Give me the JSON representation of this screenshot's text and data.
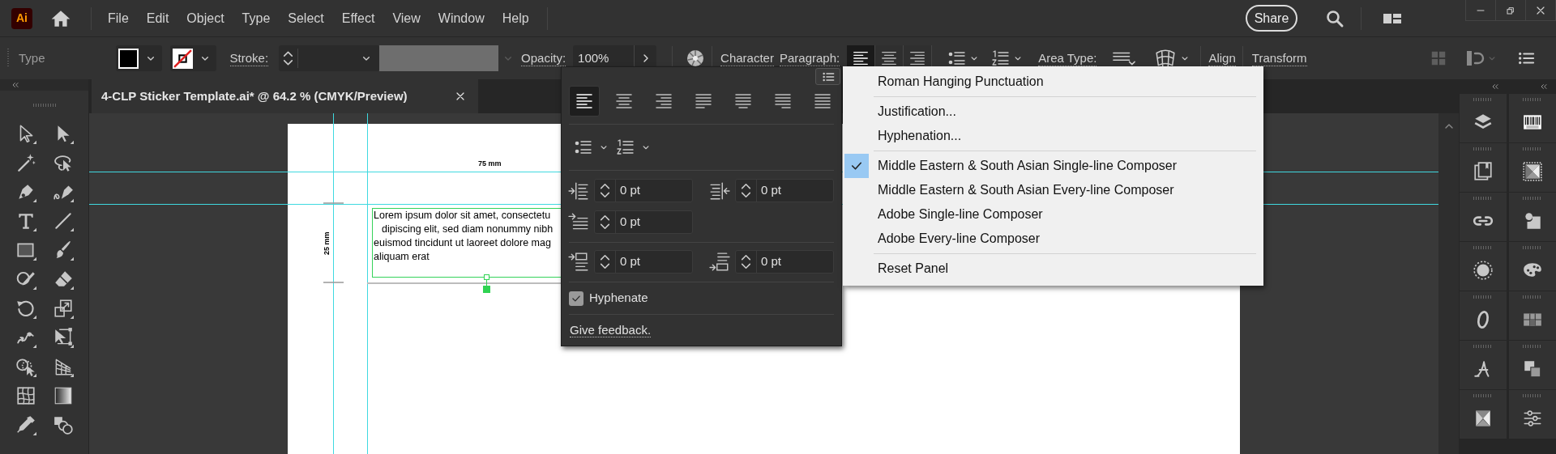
{
  "app_bar": {
    "logo": "Ai",
    "menu": [
      "File",
      "Edit",
      "Object",
      "Type",
      "Select",
      "Effect",
      "View",
      "Window",
      "Help"
    ],
    "share_button": "Share"
  },
  "control_bar": {
    "tool_name": "Type",
    "stroke_label": "Stroke:",
    "opacity_label": "Opacity:",
    "opacity_value": "100%",
    "character_link": "Character",
    "paragraph_link": "Paragraph:",
    "align_buttons": [
      {
        "kind": "left",
        "selected": true
      },
      {
        "kind": "center",
        "selected": false
      },
      {
        "kind": "right",
        "selected": false
      }
    ],
    "area_type_label": "Area Type:",
    "align_link": "Align",
    "transform_link": "Transform"
  },
  "document_tab": {
    "title": "4-CLP Sticker Template.ai* @ 64.2 % (CMYK/Preview)"
  },
  "artboard": {
    "width_label": "75 mm",
    "height_label": "25 mm",
    "text_lines": [
      "Lorem ipsum dolor sit amet, consectetu",
      "dipiscing elit, sed diam nonummy nibh",
      "euismod tincidunt ut laoreet dolore mag",
      "aliquam erat"
    ]
  },
  "paragraph_panel": {
    "alignments": [
      {
        "kind": "left",
        "selected": true
      },
      {
        "kind": "center",
        "selected": false
      },
      {
        "kind": "right",
        "selected": false
      },
      {
        "kind": "justify-left",
        "selected": false
      },
      {
        "kind": "justify-center",
        "selected": false
      },
      {
        "kind": "justify-right",
        "selected": false
      },
      {
        "kind": "justify-all",
        "selected": false
      }
    ],
    "indents": [
      {
        "kind": "left-indent",
        "value": "0 pt"
      },
      {
        "kind": "right-indent",
        "value": "0 pt"
      },
      {
        "kind": "first-line-indent",
        "value": "0 pt"
      },
      {
        "kind": "space-before",
        "value": "0 pt"
      },
      {
        "kind": "space-after",
        "value": "0 pt"
      }
    ],
    "hyphenate": {
      "label": "Hyphenate",
      "checked": true
    },
    "feedback_link": "Give feedback."
  },
  "panel_menu": {
    "items": [
      {
        "kind": "item",
        "label": "Roman Hanging Punctuation",
        "checked": false
      },
      {
        "kind": "separator"
      },
      {
        "kind": "item",
        "label": "Justification...",
        "checked": false
      },
      {
        "kind": "item",
        "label": "Hyphenation...",
        "checked": false
      },
      {
        "kind": "separator"
      },
      {
        "kind": "item",
        "label": "Middle Eastern & South Asian Single-line Composer",
        "checked": true
      },
      {
        "kind": "item",
        "label": "Middle Eastern & South Asian Every-line Composer",
        "checked": false
      },
      {
        "kind": "item",
        "label": "Adobe Single-line Composer",
        "checked": false
      },
      {
        "kind": "item",
        "label": "Adobe Every-line Composer",
        "checked": false
      },
      {
        "kind": "separator"
      },
      {
        "kind": "item",
        "label": "Reset Panel",
        "checked": false
      }
    ]
  }
}
